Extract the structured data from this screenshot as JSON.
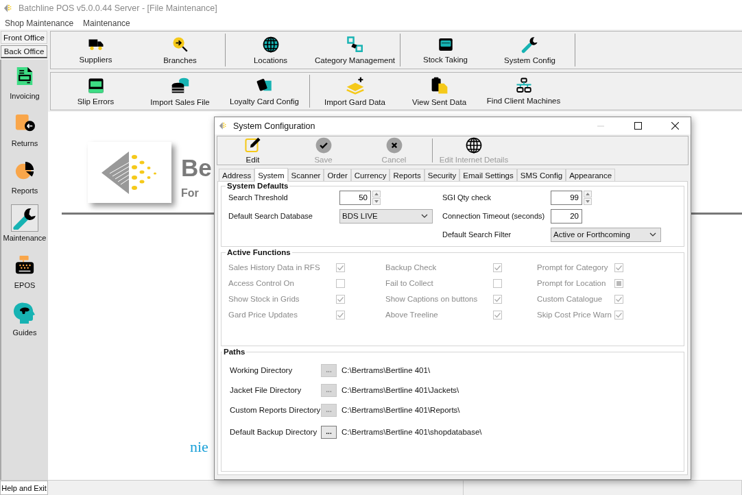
{
  "window": {
    "title": "Batchline POS v5.0.0.44 Server - [File Maintenance]"
  },
  "menu": [
    "Shop Maintenance",
    "Maintenance"
  ],
  "office_tabs": [
    {
      "label": "Front Office",
      "selected": false
    },
    {
      "label": "Back Office",
      "selected": true
    }
  ],
  "sidebar": {
    "items": [
      {
        "label": "Invoicing",
        "selected": false
      },
      {
        "label": "Returns",
        "selected": false
      },
      {
        "label": "Reports",
        "selected": false
      },
      {
        "label": "Maintenance",
        "selected": true
      },
      {
        "label": "EPOS",
        "selected": false
      },
      {
        "label": "Guides",
        "selected": false
      }
    ],
    "exit_button": "Help and Exit"
  },
  "toolbar": {
    "rows": [
      {
        "end_separator": true,
        "groups": [
          [
            "Suppliers",
            "Branches"
          ],
          [
            "Locations",
            "Category Management"
          ],
          [
            "Stock Taking",
            "System Config"
          ]
        ]
      },
      {
        "end_separator": false,
        "groups": [
          [
            "Slip Errors",
            "Import Sales File",
            "Loyalty Card Config"
          ],
          [
            "Import Gard Data",
            "View Sent Data",
            "Find Client Machines"
          ]
        ]
      }
    ]
  },
  "background": {
    "brand_text": "Be",
    "tagline": "For",
    "footer_text": "nie"
  },
  "dialog": {
    "title": "System Configuration",
    "toolbar": [
      {
        "label": "Edit",
        "disabled": false
      },
      {
        "label": "Save",
        "disabled": true
      },
      {
        "label": "Cancel",
        "disabled": true
      },
      {
        "label": "Edit Internet Details",
        "disabled": true
      }
    ],
    "tabs": [
      {
        "label": "Address",
        "selected": false
      },
      {
        "label": "System",
        "selected": true
      },
      {
        "label": "Scanner",
        "selected": false
      },
      {
        "label": "Order",
        "selected": false
      },
      {
        "label": "Currency",
        "selected": false
      },
      {
        "label": "Reports",
        "selected": false
      },
      {
        "label": "Security",
        "selected": false
      },
      {
        "label": "Email Settings",
        "selected": false
      },
      {
        "label": "SMS Config",
        "selected": false
      },
      {
        "label": "Appearance",
        "selected": false
      }
    ],
    "system_defaults": {
      "title": "System Defaults",
      "columns": [
        [
          {
            "label": "Search Threshold",
            "value": "50",
            "kind": "spin"
          },
          {
            "label": "Default Search Database",
            "value": "BDS LIVE",
            "kind": "select"
          }
        ],
        [
          {
            "label": "SGI Qty check",
            "value": "99",
            "kind": "spin"
          },
          {
            "label": "Connection Timeout (seconds)",
            "value": "20",
            "kind": "number"
          },
          {
            "label": "Default Search Filter",
            "value": "Active or Forthcoming",
            "kind": "select"
          }
        ]
      ]
    },
    "active_functions": {
      "title": "Active Functions",
      "disabled": true,
      "columns": [
        [
          {
            "label": "Sales History Data in RFS",
            "checked": true,
            "indeterminate": false
          },
          {
            "label": "Access Control On",
            "checked": false,
            "indeterminate": false
          },
          {
            "label": "Show Stock in Grids",
            "checked": true,
            "indeterminate": false
          },
          {
            "label": "Gard Price Updates",
            "checked": true,
            "indeterminate": false
          }
        ],
        [
          {
            "label": "Backup Check",
            "checked": true,
            "indeterminate": false
          },
          {
            "label": "Fail to Collect",
            "checked": false,
            "indeterminate": false
          },
          {
            "label": "Show Captions on buttons",
            "checked": true,
            "indeterminate": false
          },
          {
            "label": "Above Treeline",
            "checked": true,
            "indeterminate": false
          }
        ],
        [
          {
            "label": "Prompt for Category",
            "checked": true,
            "indeterminate": false
          },
          {
            "label": "Prompt for Location",
            "checked": false,
            "indeterminate": true
          },
          {
            "label": "Custom Catalogue",
            "checked": true,
            "indeterminate": false
          },
          {
            "label": "Skip Cost Price Warn",
            "checked": true,
            "indeterminate": false
          }
        ]
      ]
    },
    "paths": {
      "title": "Paths",
      "rows": [
        {
          "label": "Working Directory",
          "button": "...",
          "button_disabled": true,
          "value": "C:\\Bertrams\\Bertline 401\\"
        },
        {
          "label": "Jacket File Directory",
          "button": "...",
          "button_disabled": true,
          "value": "C:\\Bertrams\\Bertline 401\\Jackets\\"
        },
        {
          "label": "Custom Reports Directory",
          "button": "...",
          "button_disabled": true,
          "value": "C:\\Bertrams\\Bertline 401\\Reports\\"
        },
        {
          "label": "Default Backup Directory",
          "button": "...",
          "button_disabled": false,
          "value": "C:\\Bertrams\\Bertline 401\\shopdatabase\\"
        }
      ]
    }
  }
}
